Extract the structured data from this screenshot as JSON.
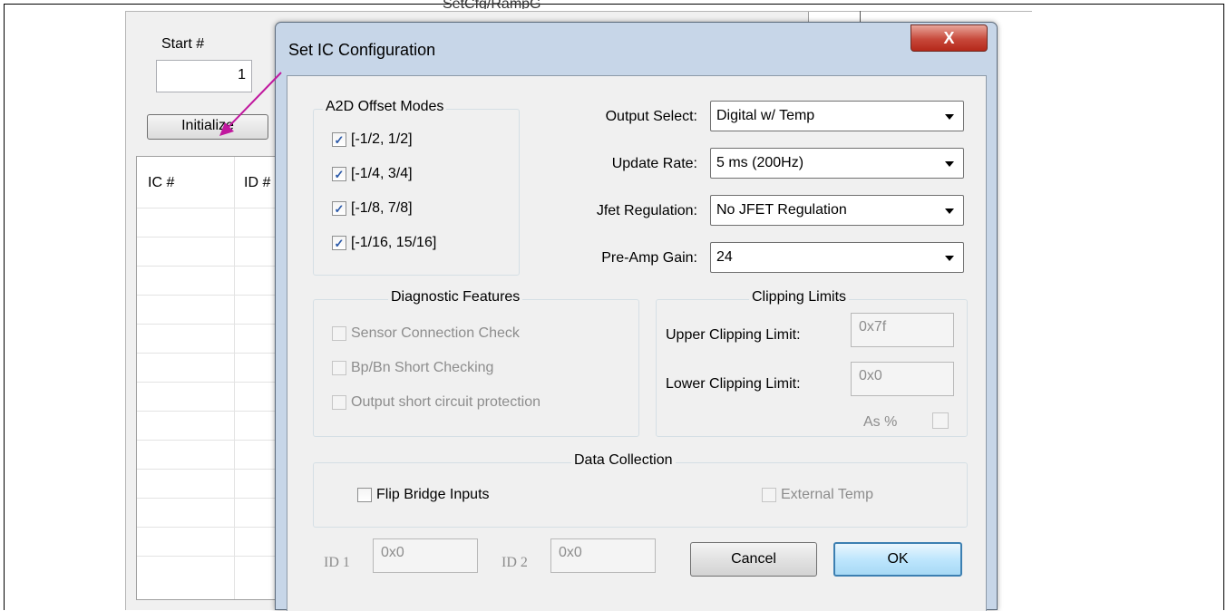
{
  "background_app": {
    "top_label": "SetCfg/RampG",
    "start_label": "Start #",
    "start_value": "1",
    "initialize_button": "Initialize",
    "table_headers": [
      "IC #",
      "ID #"
    ]
  },
  "dialog": {
    "title": "Set IC Configuration",
    "close_symbol": "X",
    "a2d_offset_modes": {
      "legend": "A2D Offset Modes",
      "items": [
        {
          "label": "[-1/2, 1/2]",
          "checked": true
        },
        {
          "label": "[-1/4, 3/4]",
          "checked": true
        },
        {
          "label": "[-1/8, 7/8]",
          "checked": true
        },
        {
          "label": "[-1/16, 15/16]",
          "checked": true
        }
      ]
    },
    "settings": {
      "output_select_label": "Output Select:",
      "output_select_value": "Digital w/ Temp",
      "update_rate_label": "Update Rate:",
      "update_rate_value": "5 ms (200Hz)",
      "jfet_regulation_label": "Jfet Regulation:",
      "jfet_regulation_value": "No JFET Regulation",
      "preamp_gain_label": "Pre-Amp Gain:",
      "preamp_gain_value": "24"
    },
    "diagnostic_features": {
      "legend": "Diagnostic Features",
      "items": [
        {
          "label": "Sensor Connection Check",
          "checked": false
        },
        {
          "label": "Bp/Bn Short Checking",
          "checked": false
        },
        {
          "label": "Output short circuit protection",
          "checked": false
        }
      ]
    },
    "clipping_limits": {
      "legend": "Clipping Limits",
      "upper_label": "Upper Clipping Limit:",
      "upper_value": "0x7f",
      "lower_label": "Lower Clipping Limit:",
      "lower_value": "0x0",
      "as_percent_label": "As %"
    },
    "data_collection": {
      "legend": "Data Collection",
      "flip_bridge_label": "Flip Bridge Inputs",
      "external_temp_label": "External Temp"
    },
    "id1_label": "ID 1",
    "id1_value": "0x0",
    "id2_label": "ID 2",
    "id2_value": "0x0",
    "cancel_button": "Cancel",
    "ok_button": "OK"
  },
  "colors": {
    "annotation_arrow": "#c0189e",
    "close_button": "#c7483a",
    "ok_border": "#3c7fb1"
  }
}
